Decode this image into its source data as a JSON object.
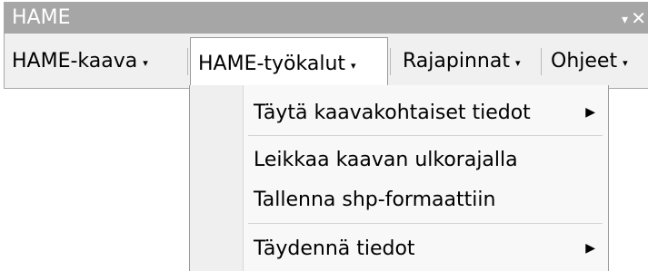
{
  "window": {
    "title": "HAME",
    "dropdown_glyph": "▾",
    "close_glyph": "✕"
  },
  "menubar": {
    "items": [
      {
        "label": "HAME-kaava",
        "caret": "▾"
      },
      {
        "label": "HAME-työkalut",
        "caret": "▾"
      },
      {
        "label": "Rajapinnat",
        "caret": "▾"
      },
      {
        "label": "Ohjeet",
        "caret": "▾"
      }
    ]
  },
  "dropdown": {
    "items": [
      {
        "label": "Täytä kaavakohtaiset tiedot",
        "submenu_arrow": "▶"
      },
      {
        "label": "Leikkaa kaavan ulkorajalla"
      },
      {
        "label": "Tallenna shp-formaattiin"
      },
      {
        "label": "Täydennä tiedot",
        "submenu_arrow": "▶"
      }
    ]
  },
  "colors": {
    "titlebar": "#a6a6a6",
    "menubar": "#f0f0f0",
    "dropdown_bg": "#f8f8f8"
  }
}
